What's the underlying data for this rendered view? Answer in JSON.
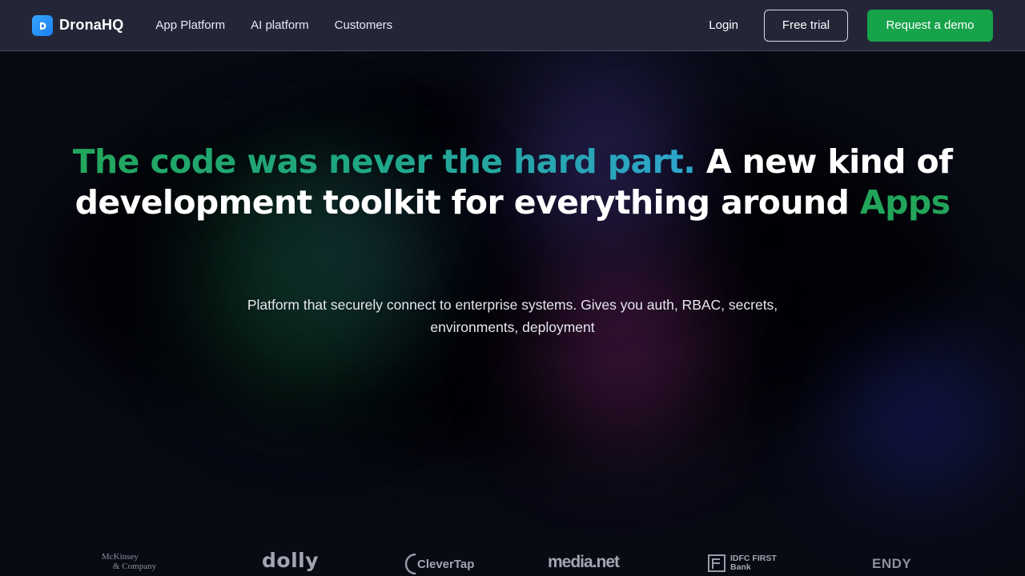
{
  "nav": {
    "brand": "DronaHQ",
    "links": [
      "App Platform",
      "AI platform",
      "Customers"
    ],
    "login": "Login",
    "free_trial": "Free trial",
    "request_demo": "Request a demo"
  },
  "hero": {
    "headline_grad": "The code was never the hard part.",
    "headline_mid": " A new kind of development toolkit for everything around ",
    "headline_apps": "Apps",
    "sub_line1": "Platform that securely connect to enterprise systems. Gives you auth, RBAC, secrets,",
    "sub_line2": "environments, deployment"
  },
  "customers": {
    "mckinsey_1": "McKinsey",
    "mckinsey_2": "& Company",
    "dolly": "dolly",
    "clevertap": "CleverTap",
    "medianet": "media.net",
    "idfc_1": "IDFC FIRST",
    "idfc_2": "Bank",
    "endy": "ENDY"
  },
  "colors": {
    "nav_bg": "#242638",
    "page_bg": "#070912",
    "accent_green": "#16a34a",
    "headline_gradient_start": "#22a75a",
    "headline_gradient_end": "#2ea5cf"
  },
  "icons": {
    "brand_logo": "dronahq-logo-icon"
  }
}
